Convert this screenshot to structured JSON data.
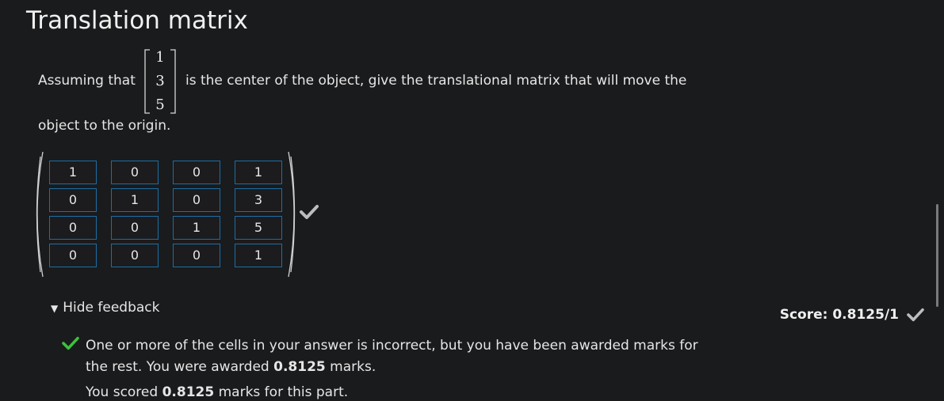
{
  "page": {
    "title": "Translation matrix",
    "prompt_before": "Assuming that",
    "prompt_after": "is the center of the object, give the translational matrix that will move the",
    "prompt_line2": "object to the origin.",
    "vector": [
      "1",
      "3",
      "5"
    ]
  },
  "matrix": {
    "rows": [
      [
        "1",
        "0",
        "0",
        "1"
      ],
      [
        "0",
        "1",
        "0",
        "3"
      ],
      [
        "0",
        "0",
        "1",
        "5"
      ],
      [
        "0",
        "0",
        "0",
        "1"
      ]
    ]
  },
  "feedback": {
    "toggle_label": "Hide feedback",
    "message_1": "One or more of the cells in your answer is incorrect, but you have been awarded marks for the rest. You were awarded ",
    "awarded": "0.8125",
    "message_1_end": " marks.",
    "message_2_start": "You scored ",
    "scored": "0.8125",
    "message_2_end": " marks for this part."
  },
  "score": {
    "label": "Score: 0.8125/1"
  },
  "colors": {
    "background": "#1a1b1d",
    "cell_border": "#1c6ea4",
    "check_green": "#3cc13b",
    "check_gray": "#bdbdbd"
  }
}
